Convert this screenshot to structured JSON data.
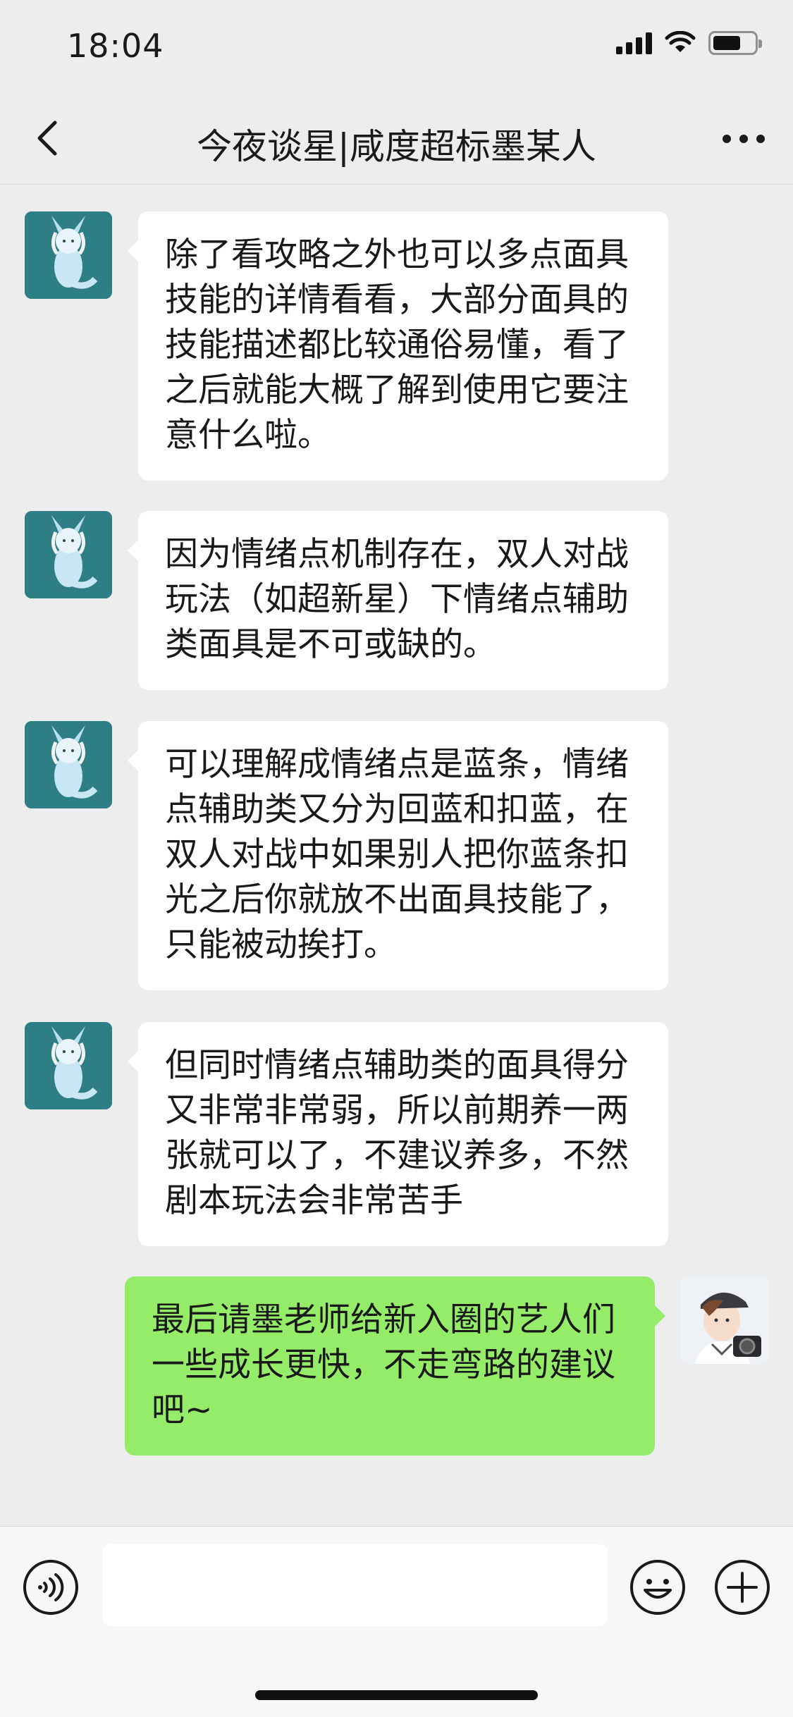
{
  "status_bar": {
    "time": "18:04"
  },
  "header": {
    "title": "今夜谈星|咸度超标墨某人"
  },
  "messages": [
    {
      "sender": "other",
      "avatar": "ice-fox-avatar",
      "text": "除了看攻略之外也可以多点面具技能的详情看看，大部分面具的技能描述都比较通俗易懂，看了之后就能大概了解到使用它要注意什么啦。"
    },
    {
      "sender": "other",
      "avatar": "ice-fox-avatar",
      "text": "因为情绪点机制存在，双人对战玩法（如超新星）下情绪点辅助类面具是不可或缺的。"
    },
    {
      "sender": "other",
      "avatar": "ice-fox-avatar",
      "text": "可以理解成情绪点是蓝条，情绪点辅助类又分为回蓝和扣蓝，在双人对战中如果别人把你蓝条扣光之后你就放不出面具技能了，只能被动挨打。"
    },
    {
      "sender": "other",
      "avatar": "ice-fox-avatar",
      "text": "但同时情绪点辅助类的面具得分又非常非常弱，所以前期养一两张就可以了，不建议养多，不然剧本玩法会非常苦手"
    },
    {
      "sender": "self",
      "avatar": "photographer-avatar",
      "text": "最后请墨老师给新入圈的艺人们一些成长更快，不走弯路的建议吧~"
    }
  ],
  "input_bar": {
    "value": ""
  },
  "colors": {
    "background": "#ededed",
    "incoming_bubble": "#ffffff",
    "outgoing_bubble": "#95ec69",
    "text": "#191919"
  }
}
